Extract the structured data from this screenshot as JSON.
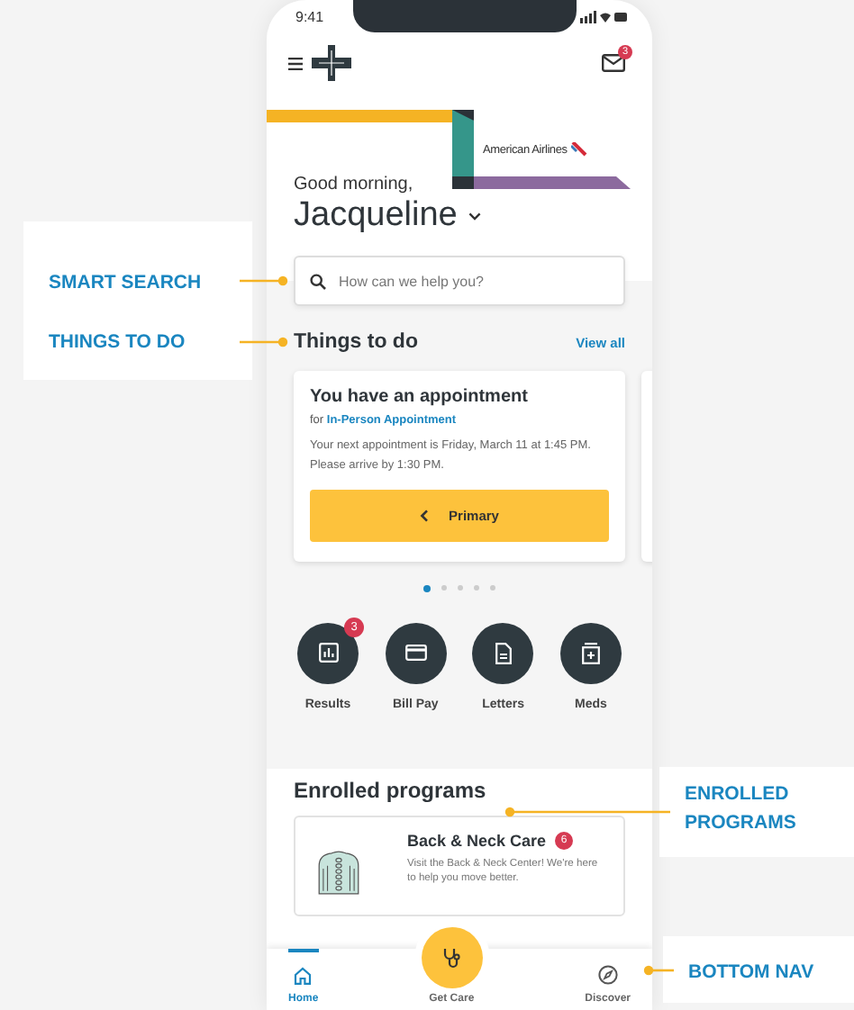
{
  "status_bar": {
    "time": "9:41"
  },
  "header": {
    "mail_badge": "3"
  },
  "sponsor": {
    "name": "American Airlines"
  },
  "greeting": {
    "salutation": "Good morning,",
    "name": "Jacqueline"
  },
  "search": {
    "placeholder": "How can we help you?"
  },
  "things_to_do": {
    "title": "Things to do",
    "link": "View all",
    "cards": [
      {
        "title": "You have an appointment",
        "for_label": "for",
        "for_value": "In-Person Appointment",
        "body": "Your next appointment is Friday, March 11 at 1:45 PM. Please arrive by 1:30 PM.",
        "button": "Primary"
      }
    ],
    "pager": [
      {
        "selected": true
      },
      {
        "selected": false
      },
      {
        "selected": false
      },
      {
        "selected": false
      },
      {
        "selected": false
      }
    ]
  },
  "quick_actions": [
    {
      "label": "Results",
      "badge": "3",
      "kind": "chart"
    },
    {
      "label": "Bill Pay",
      "kind": "card"
    },
    {
      "label": "Letters",
      "kind": "document"
    },
    {
      "label": "Meds",
      "kind": "medicine"
    }
  ],
  "enrolled": {
    "title": "Enrolled programs",
    "programs": [
      {
        "title": "Back & Neck Care",
        "badge": "6",
        "description": "Visit the Back & Neck Center! We're here to help you move better."
      }
    ]
  },
  "bottom_nav": [
    {
      "label": "Home",
      "kind": "home",
      "selected": true
    },
    {
      "label": "Get Care",
      "kind": "action",
      "selected": false
    },
    {
      "label": "Discover",
      "kind": "discover",
      "selected": false
    }
  ],
  "callouts": [
    {
      "label": "SMART SEARCH"
    },
    {
      "label": "THINGS TO DO"
    },
    {
      "label": "ENROLLED PROGRAMS"
    },
    {
      "label": "BOTTOM NAV"
    }
  ]
}
